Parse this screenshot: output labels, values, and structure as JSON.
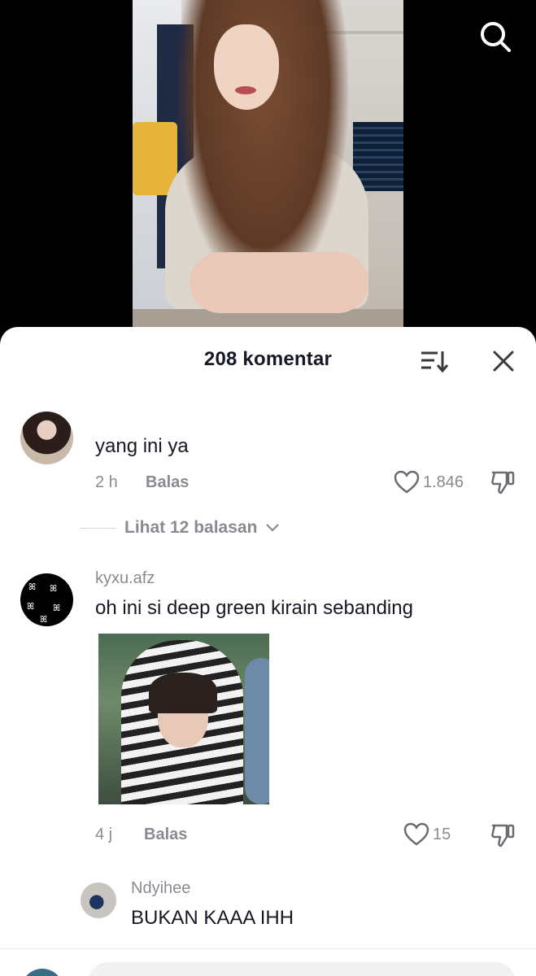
{
  "header": {
    "title": "208 komentar"
  },
  "icons": {
    "search": "search-icon",
    "sort": "sort-icon",
    "close": "close-icon",
    "heart": "heart-icon",
    "dislike": "dislike-icon",
    "chevron": "chevron-down-icon"
  },
  "comments": [
    {
      "name": "",
      "text": "yang ini ya",
      "time": "2 h",
      "reply_label": "Balas",
      "likes": "1.846",
      "view_replies": "Lihat 12 balasan"
    },
    {
      "name": "kyxu.afz",
      "text": "oh ini si deep green kirain sebanding",
      "time": "4 j",
      "reply_label": "Balas",
      "likes": "15"
    }
  ],
  "reply": {
    "name": "Ndyihee",
    "text": "BUKAN KAAA IHH"
  },
  "colors": {
    "text_primary": "#161823",
    "text_secondary": "#8a8b91",
    "sheet_bg": "#ffffff"
  }
}
